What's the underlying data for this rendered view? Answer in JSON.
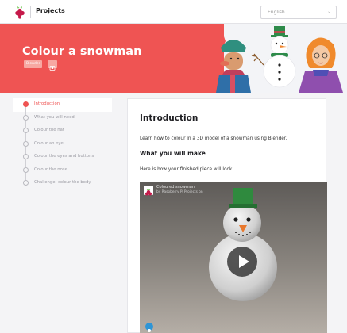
{
  "header": {
    "brand": "Projects",
    "language": "English",
    "chevron": "⌄"
  },
  "hero": {
    "title": "Colour a snowman",
    "badge": "Blender"
  },
  "sidebar": {
    "steps": [
      {
        "label": "Introduction",
        "active": true
      },
      {
        "label": "What you will need",
        "active": false
      },
      {
        "label": "Colour the hat",
        "active": false
      },
      {
        "label": "Colour an eye",
        "active": false
      },
      {
        "label": "Colour the eyes and buttons",
        "active": false
      },
      {
        "label": "Colour the nose",
        "active": false
      },
      {
        "label": "Challenge: colour the body",
        "active": false
      }
    ]
  },
  "main": {
    "heading": "Introduction",
    "intro": "Learn how to colour in a 3D model of a snowman using Blender.",
    "subheading": "What you will make",
    "finished_text": "Here is how your finished piece will look:",
    "video": {
      "title": "Coloured snowman",
      "subtitle": "by Raspberry Pi Projects on"
    }
  },
  "colors": {
    "accent": "#ef5453",
    "hero_background": "#ef5453",
    "active_step": "#ef5453"
  }
}
